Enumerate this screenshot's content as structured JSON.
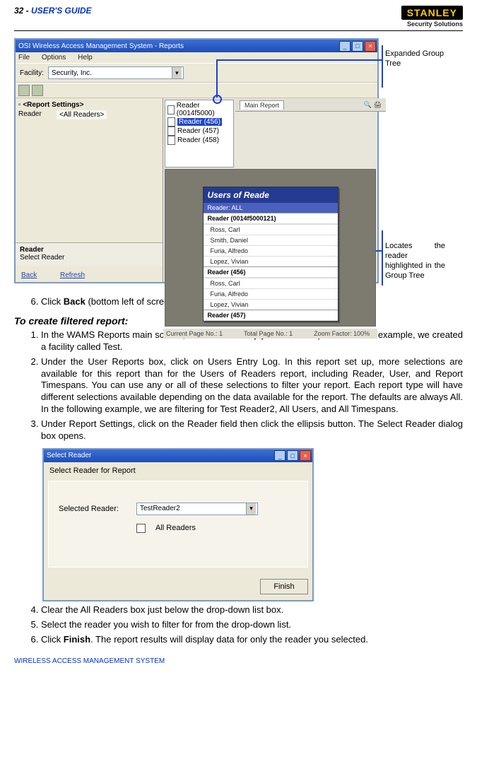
{
  "header": {
    "page_label": "32 - ",
    "guide_label": "USER'S GUIDE",
    "brand": "STANLEY",
    "brand_sub": "Security Solutions"
  },
  "annotations": {
    "expanded": "Expanded Group Tree",
    "locates_1": "Locates the reader",
    "locates_2": "highlighted in the Group Tree"
  },
  "win1": {
    "title": "OSI Wireless Access Management System - Reports",
    "menu": {
      "file": "File",
      "options": "Options",
      "help": "Help"
    },
    "facility_label": "Facility:",
    "facility_value": "Security, Inc.",
    "report_settings_title": "<Report Settings>",
    "reader_label": "Reader",
    "reader_value": "<All Readers>",
    "reader_box_title": "Reader",
    "reader_box_text": "Select Reader",
    "link_back": "Back",
    "link_refresh": "Refresh",
    "tree_items": [
      "Reader (0014f5000)",
      "Reader (456)",
      "Reader (457)",
      "Reader (458)"
    ],
    "tree_sel_index": 1,
    "report_tab": "Main Report",
    "rp_title": "Users of Reade",
    "rp_reader_all": "Reader: ALL",
    "rp_sections": [
      {
        "t": "Reader (0014f5000121)",
        "names": [
          "Ross, Carl",
          "Smith, Daniel",
          "Furia, Alfredo",
          "Lopez, Vivian"
        ]
      },
      {
        "t": "Reader (456)",
        "names": [
          "Ross, Carl",
          "Furia, Alfredo",
          "Lopez, Vivian"
        ]
      },
      {
        "t": "Reader (457)",
        "names": []
      }
    ],
    "status": {
      "cur": "Current Page No.: 1",
      "tot": "Total Page No.: 1",
      "zoom": "Zoom Factor: 100%"
    }
  },
  "step6": "Click ",
  "step6_bold": "Back",
  "step6_rest": " (bottom left of screen) to return to the Report Generator screen.",
  "section_head": "To create filtered report:",
  "steps2": [
    "In the WAMS Reports main screen, select the Facility you wish to report on.   In our example, we created a facility called Test.",
    "Under the User Reports box, click on Users Entry Log. In this report set up, more selections are available for this report than for the Users of Readers report, including Reader, User, and Report Timespans.   You can use any or all of these selections to filter your report.   Each report type will have different selections available depending on the data available for the report. The defaults are always All. In the following example, we are filtering for Test Reader2, All Users, and All Timespans.",
    "Under Report Settings, click on the Reader field then click the ellipsis button.   The Select Reader dialog box opens."
  ],
  "dlg": {
    "title": "Select Reader",
    "panel_title": "Select Reader for Report",
    "sel_label": "Selected Reader:",
    "sel_value": "TestReader2",
    "all_readers": "All Readers",
    "finish": "Finish"
  },
  "steps3": [
    "Clear the All Readers box just below the drop-down list box.",
    "Select the reader you wish to filter for from the drop-down list."
  ],
  "step_finish_a": "Click ",
  "step_finish_bold": "Finish",
  "step_finish_b": ".   The report results will display data for only the reader you selected.",
  "footer": "WIRELESS ACCESS MANAGEMENT SYSTEM"
}
